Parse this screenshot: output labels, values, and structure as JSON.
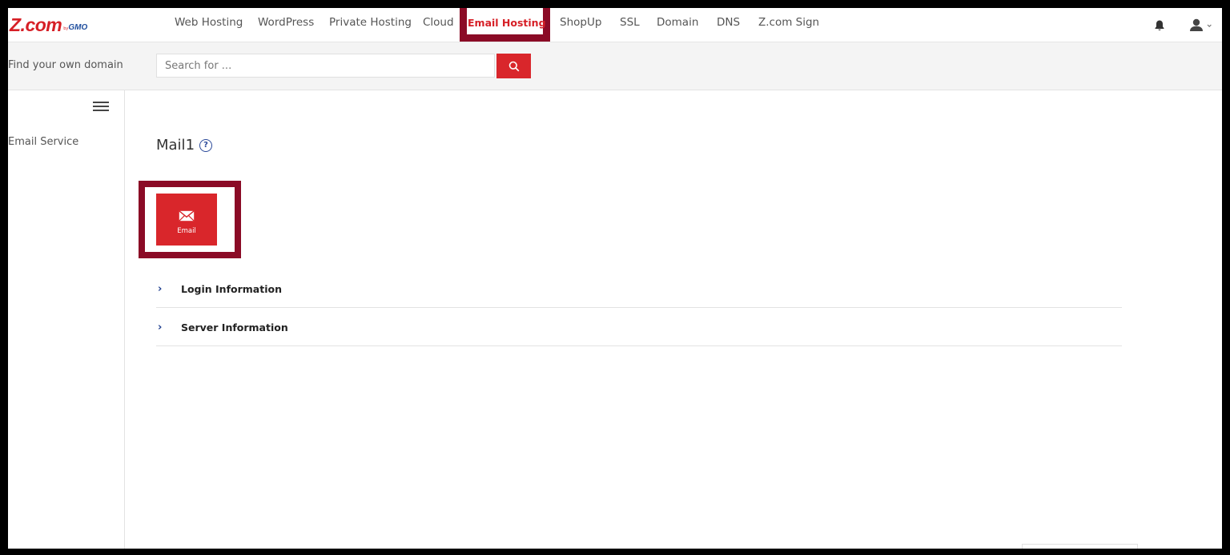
{
  "brand": {
    "logo_main": "Z.com",
    "logo_by": "by",
    "logo_gmo": "GMO"
  },
  "nav": {
    "items": [
      {
        "label": "Web Hosting",
        "active": false
      },
      {
        "label": "WordPress",
        "active": false
      },
      {
        "label": "Private Hosting",
        "active": false
      },
      {
        "label": "Cloud",
        "active": false
      },
      {
        "label": "Email Hosting",
        "active": true
      },
      {
        "label": "ShopUp",
        "active": false
      },
      {
        "label": "SSL",
        "active": false
      },
      {
        "label": "Domain",
        "active": false
      },
      {
        "label": "DNS",
        "active": false
      },
      {
        "label": "Z.com Sign",
        "active": false
      }
    ]
  },
  "header_icons": {
    "notification": "bell-icon",
    "account": "user-icon"
  },
  "search": {
    "label": "Find your own domain",
    "placeholder": "Search for ...",
    "value": "",
    "button_icon": "search-icon"
  },
  "sidebar": {
    "menu_icon": "hamburger-icon",
    "items": [
      {
        "label": "Email Service"
      }
    ]
  },
  "main": {
    "title": "Mail1",
    "help_glyph": "?",
    "tiles": [
      {
        "label": "Email",
        "icon": "envelope-icon"
      }
    ],
    "sections": [
      {
        "label": "Login Information",
        "chevron": "›"
      },
      {
        "label": "Server Information",
        "chevron": "›"
      }
    ]
  },
  "colors": {
    "accent_red": "#d9262b",
    "highlight_maroon": "#8b0b26",
    "link_blue": "#1f3f8f"
  }
}
